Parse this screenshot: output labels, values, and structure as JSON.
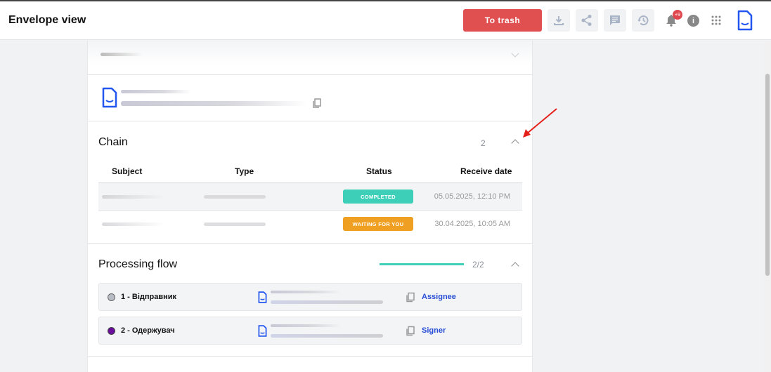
{
  "header": {
    "title": "Envelope view",
    "trash_label": "To trash",
    "notification_count": "+9"
  },
  "chain": {
    "title": "Chain",
    "count": "2",
    "columns": [
      "Subject",
      "Type",
      "Status",
      "Receive date"
    ],
    "rows": [
      {
        "status": "COMPLETED",
        "status_color": "#3ecfb8",
        "date": "05.05.2025, 12:10 PM"
      },
      {
        "status": "WAITING FOR YOU",
        "status_color": "#efa022",
        "date": "30.04.2025, 10:05 AM"
      }
    ]
  },
  "flow": {
    "title": "Processing flow",
    "progress_text": "2/2",
    "progress": 1.0,
    "steps": [
      {
        "name": "1 - Відправник",
        "role": "Assignee",
        "dot_color": "#b8bcc4"
      },
      {
        "name": "2 - Одержувач",
        "role": "Signer",
        "dot_color": "#6a0d9c"
      }
    ]
  }
}
